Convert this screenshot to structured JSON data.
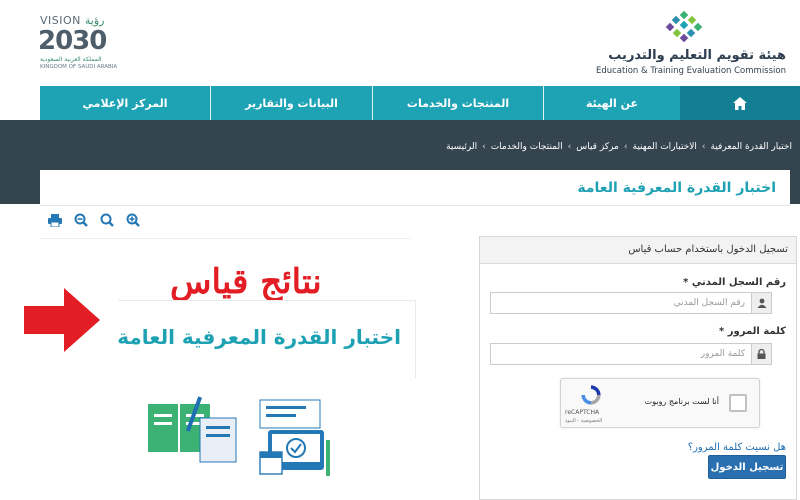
{
  "header": {
    "org_title": "هيئة تقويم التعليم والتدريب",
    "org_subtitle": "Education & Training Evaluation Commission",
    "vision": {
      "top": "VISION",
      "top_ar": "رؤية",
      "year": "2030",
      "line1": "المملكة العربية السعودية",
      "line2": "KINGDOM OF SAUDI ARABIA"
    }
  },
  "nav": {
    "home_icon": "home-icon",
    "items": [
      {
        "label": "عن الهيئة"
      },
      {
        "label": "المنتجات والخدمات"
      },
      {
        "label": "البيانات والتقارير"
      },
      {
        "label": "المركز الإعلامي"
      }
    ]
  },
  "breadcrumb": {
    "items": [
      "الرئيسية",
      "المنتجات والخدمات",
      "مركز قياس",
      "الاختبارات المهنية",
      "اختبار القدرة المعرفية"
    ],
    "separator": "›"
  },
  "page": {
    "title": "اختبار القدرة المعرفية العامة"
  },
  "toolbar": {
    "icons": [
      "print-icon",
      "zoom-out-icon",
      "zoom-reset-icon",
      "zoom-in-icon"
    ]
  },
  "promo": {
    "heading": "نتائج قياس",
    "subheading": "اختبار القدرة المعرفية العامة"
  },
  "login": {
    "header": "تسجيل الدخول باستخدام حساب قياس",
    "id_label": "رقم السجل المدني",
    "id_required": "*",
    "id_placeholder": "رقم السجل المدني",
    "password_label": "كلمة المرور",
    "password_required": "*",
    "password_placeholder": "كلمة المرور",
    "captcha_text": "أنا لست برنامج روبوت",
    "captcha_brand": "reCAPTCHA",
    "captcha_terms": "الخصوصية - البنود",
    "forgot": "هل نسيت كلمة المرور؟",
    "submit": "تسجيل الدخول"
  },
  "colors": {
    "nav": "#1ea3b5",
    "nav_home": "#127f94",
    "band": "#34454f",
    "accent": "#1fa1b4",
    "promo_red": "#e21d24",
    "submit": "#2a6fb0"
  }
}
